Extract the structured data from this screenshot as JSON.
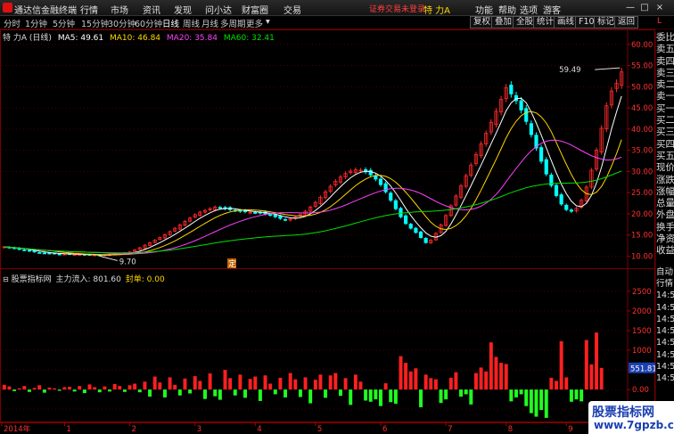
{
  "titlebar": {
    "app_title": "通达信金融终端",
    "menus": [
      "行情",
      "市场",
      "资讯",
      "发现",
      "问小达",
      "财富圈",
      "交易"
    ],
    "login_warning": "证券交易未登录",
    "stock_title": "特 力A",
    "right_menus": [
      "功能",
      "帮助",
      "选项",
      "游客"
    ],
    "win_buttons": [
      "—",
      "□",
      "×"
    ]
  },
  "toolbar": {
    "periods": [
      "分时",
      "1分钟",
      "5分钟",
      "15分钟",
      "30分钟",
      "60分钟",
      "日线",
      "周线",
      "月线",
      "多周期",
      "更多"
    ],
    "active_period": "日线",
    "tools": [
      "复权",
      "叠加",
      "全股",
      "统计",
      "画线",
      "F10",
      "标记",
      "返回"
    ]
  },
  "main_info": {
    "stock": "特 力A",
    "period": "(日线)",
    "ma5": "MA5: 49.61",
    "ma10": "MA10: 46.84",
    "ma20": "MA20: 35.84",
    "ma60": "MA60: 32.41"
  },
  "indicator_info": {
    "name": "股票指标网",
    "label": "主力流入: 801.60",
    "seal": "封单: 0.00"
  },
  "price_axis": [
    "60.00",
    "55.00",
    "50.00",
    "45.00",
    "40.00",
    "35.00",
    "30.00",
    "25.00",
    "20.00",
    "15.00",
    "10.00"
  ],
  "indicator_axis": [
    "2500",
    "2000",
    "1500",
    "1000",
    "500.00",
    "0.00",
    "-500.0"
  ],
  "indicator_current_value": "551.81",
  "annotations": {
    "high_price": "59.49",
    "low_price": "9.70",
    "marker": "定"
  },
  "x_axis": [
    "2014年",
    "1",
    "2",
    "3",
    "4",
    "5",
    "6",
    "7",
    "8",
    "9"
  ],
  "right_panel": {
    "corner_label": "L",
    "upper": [
      "委比",
      "卖五",
      "卖四",
      "卖三",
      "卖二",
      "卖一",
      "买一",
      "买二",
      "买三",
      "买四",
      "买五",
      "现价",
      "涨跌",
      "涨幅",
      "总量",
      "外盘",
      "换手",
      "净资",
      "收益"
    ],
    "lower": [
      "自动",
      "行情",
      "14:56",
      "14:56",
      "14:56",
      "14:56",
      "14:56",
      "14:56",
      "14:56",
      "14:56"
    ]
  },
  "watermark": {
    "title": "股票指标网",
    "url": "www.7gpzb.com"
  },
  "colors": {
    "up": "#ff2a2a",
    "down": "#00ffff",
    "ma5": "#ffffff",
    "ma10": "#ffd700",
    "ma20": "#ff40ff",
    "ma60": "#00e000",
    "inflow": "#ff2020",
    "outflow": "#20ff20"
  },
  "chart_data": {
    "type": "candlestick+bar",
    "price_range": [
      8,
      61
    ],
    "indicator_range": [
      -700,
      2700
    ],
    "close": [
      12.2,
      12.0,
      11.8,
      11.6,
      11.4,
      11.2,
      11.0,
      10.8,
      10.7,
      10.6,
      10.6,
      10.5,
      10.5,
      10.5,
      10.4,
      10.4,
      10.3,
      10.3,
      10.3,
      10.2,
      10.3,
      10.4,
      10.5,
      10.6,
      10.8,
      11.0,
      11.5,
      12.0,
      12.6,
      13.2,
      13.8,
      14.4,
      15.1,
      15.8,
      16.6,
      17.4,
      18.2,
      19.0,
      19.8,
      20.4,
      20.8,
      21.2,
      21.6,
      21.4,
      21.2,
      21.0,
      20.8,
      20.6,
      20.5,
      20.4,
      20.3,
      20.2,
      20.0,
      19.7,
      19.3,
      18.9,
      18.6,
      18.8,
      19.2,
      19.8,
      20.6,
      21.6,
      22.7,
      23.9,
      25.2,
      26.5,
      27.7,
      28.7,
      29.5,
      30.1,
      30.4,
      30.3,
      29.9,
      29.2,
      28.2,
      26.9,
      25.2,
      23.2,
      21.2,
      19.3,
      17.7,
      16.6,
      15.6,
      14.4,
      13.2,
      13.8,
      15.4,
      17.4,
      19.6,
      21.9,
      24.2,
      26.6,
      29.0,
      31.5,
      34.0,
      36.5,
      39.0,
      41.6,
      44.2,
      47.0,
      49.8,
      48.3,
      46.7,
      44.5,
      41.8,
      38.7,
      35.5,
      32.4,
      29.4,
      26.7,
      24.3,
      22.3,
      21.0,
      20.6,
      21.3,
      23.2,
      26.3,
      30.3,
      35.0,
      40.2,
      45.5,
      49.0,
      50.8,
      53.5
    ],
    "inflow": [
      120,
      80,
      -40,
      30,
      90,
      -60,
      40,
      110,
      -80,
      50,
      30,
      -30,
      60,
      70,
      -50,
      90,
      -90,
      130,
      60,
      -70,
      80,
      -50,
      140,
      90,
      -60,
      110,
      150,
      -70,
      200,
      -180,
      330,
      180,
      -200,
      310,
      120,
      -150,
      280,
      -100,
      340,
      220,
      -240,
      410,
      -170,
      -260,
      500,
      290,
      -150,
      380,
      -210,
      270,
      330,
      -290,
      360,
      150,
      -120,
      300,
      -200,
      420,
      260,
      -190,
      310,
      -350,
      250,
      380,
      -210,
      360,
      420,
      -160,
      290,
      -390,
      380,
      200,
      -280,
      -310,
      -250,
      -420,
      160,
      -320,
      -360,
      850,
      680,
      460,
      540,
      -450,
      380,
      290,
      260,
      -340,
      -250,
      300,
      440,
      -180,
      -120,
      -380,
      420,
      560,
      460,
      1200,
      830,
      680,
      650,
      -300,
      -200,
      -120,
      -420,
      -600,
      -690,
      -520,
      -720,
      300,
      220,
      1230,
      310,
      -310,
      -250,
      -300,
      1260,
      640,
      1450,
      550
    ]
  }
}
